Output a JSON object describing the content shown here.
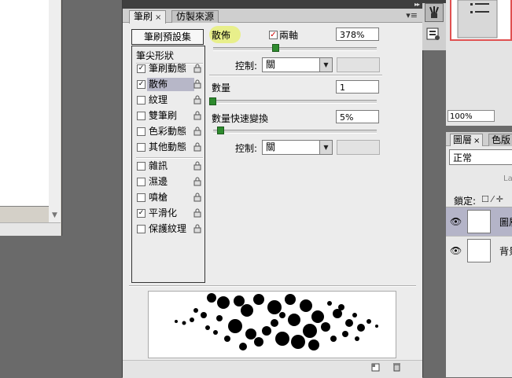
{
  "brush_panel": {
    "tabs": [
      {
        "label": "筆刷",
        "close": "×"
      },
      {
        "label": "仿製來源"
      }
    ],
    "menu_icon": "▾≡",
    "collapse_icon": "▸▸",
    "presets_button": "筆刷預設集",
    "list_header": "筆尖形狀",
    "options": [
      {
        "label": "筆刷動態",
        "checked": true
      },
      {
        "label": "散佈",
        "checked": true,
        "selected": true
      },
      {
        "label": "紋理",
        "checked": false
      },
      {
        "label": "雙筆刷",
        "checked": false
      },
      {
        "label": "色彩動態",
        "checked": false
      },
      {
        "label": "其他動態",
        "checked": false
      },
      {
        "label": "雜訊",
        "checked": false
      },
      {
        "label": "濕邊",
        "checked": false
      },
      {
        "label": "噴槍",
        "checked": false
      },
      {
        "label": "平滑化",
        "checked": true
      },
      {
        "label": "保護紋理",
        "checked": false
      }
    ],
    "scatter": {
      "label": "散佈",
      "both_axes_label": "兩軸",
      "both_axes_checked": true,
      "value": "378%",
      "slider_fraction": 0.38,
      "control_label": "控制:",
      "control_value": "關"
    },
    "count": {
      "label": "數量",
      "value": "1",
      "slider_fraction": 0.0
    },
    "count_jitter": {
      "label": "數量快速變換",
      "value": "5%",
      "slider_fraction": 0.05,
      "control_label": "控制:",
      "control_value": "關"
    },
    "check_mark": "✓",
    "colors": {
      "selected_bg": "#b7b7c8",
      "slider_thumb": "#2e8b2e",
      "highlight": "#e8f07a"
    }
  },
  "navigator": {
    "zoom": "100%"
  },
  "layers_panel": {
    "tabs": [
      {
        "label": "圖層",
        "close": "×"
      },
      {
        "label": "色版"
      }
    ],
    "blend_mode": "正常",
    "opacity_cut": "La",
    "lock_label": "鎖定:",
    "lock_icons": "☐ ⁄ ✛",
    "layers": [
      {
        "name": "圖層",
        "visible": true,
        "selected": true
      },
      {
        "name": "背景",
        "visible": true,
        "selected": false
      }
    ],
    "eye_icon": "👁"
  }
}
